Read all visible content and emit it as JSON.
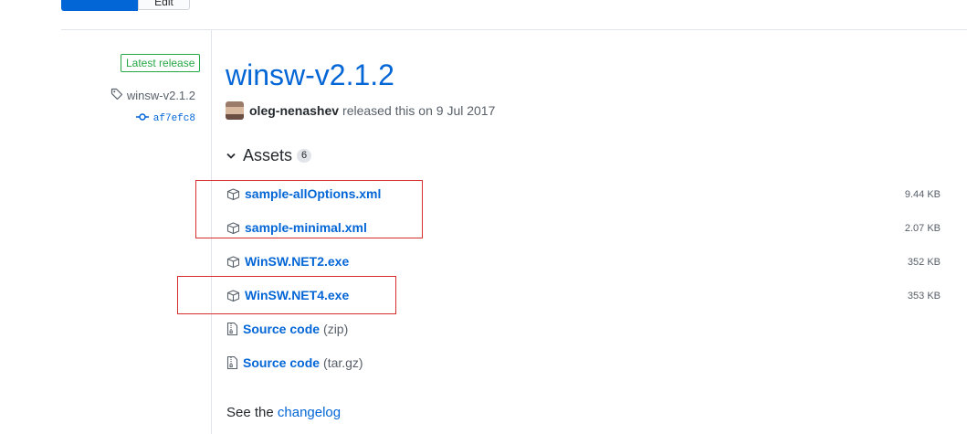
{
  "top_buttons": {
    "secondary_label": "Edit"
  },
  "sidebar": {
    "latest_badge": "Latest release",
    "tag": "winsw-v2.1.2",
    "commit": "af7efc8"
  },
  "release": {
    "title": "winsw-v2.1.2",
    "author": "oleg-nenashev",
    "released_text": "released this on 9 Jul 2017"
  },
  "assets": {
    "title": "Assets",
    "count": "6",
    "items": [
      {
        "name": "sample-allOptions.xml",
        "size": "9.44 KB"
      },
      {
        "name": "sample-minimal.xml",
        "size": "2.07 KB"
      },
      {
        "name": "WinSW.NET2.exe",
        "size": "352 KB"
      },
      {
        "name": "WinSW.NET4.exe",
        "size": "353 KB"
      },
      {
        "name": "Source code",
        "suffix": "(zip)"
      },
      {
        "name": "Source code",
        "suffix": "(tar.gz)"
      }
    ]
  },
  "footer": {
    "prefix": "See the",
    "link": "changelog"
  },
  "colors": {
    "link": "#0366d6",
    "latest_green": "#28a745",
    "highlight_red": "#d62d2d"
  },
  "icons": [
    "tag-icon",
    "commit-icon",
    "chevron-down-icon",
    "package-icon",
    "file-zip-icon"
  ]
}
